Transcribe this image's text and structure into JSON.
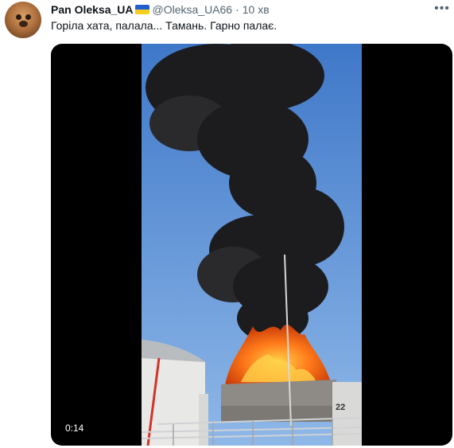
{
  "tweet": {
    "author_name": "Pan Oleksa_UA",
    "flag_icon": "ukraine-flag-icon",
    "handle": "@Oleksa_UA66",
    "separator": "·",
    "time": "10 хв",
    "more_icon": "more-icon",
    "text": "Горіла хата, палала... Тамань. Гарно палає."
  },
  "video": {
    "tank_number": "22",
    "timestamp": "0:14"
  },
  "colors": {
    "sky": "#5b8fd6",
    "smoke": "#1c1c1e",
    "fire": "#ff7a1a",
    "secondary_text": "#536471"
  }
}
